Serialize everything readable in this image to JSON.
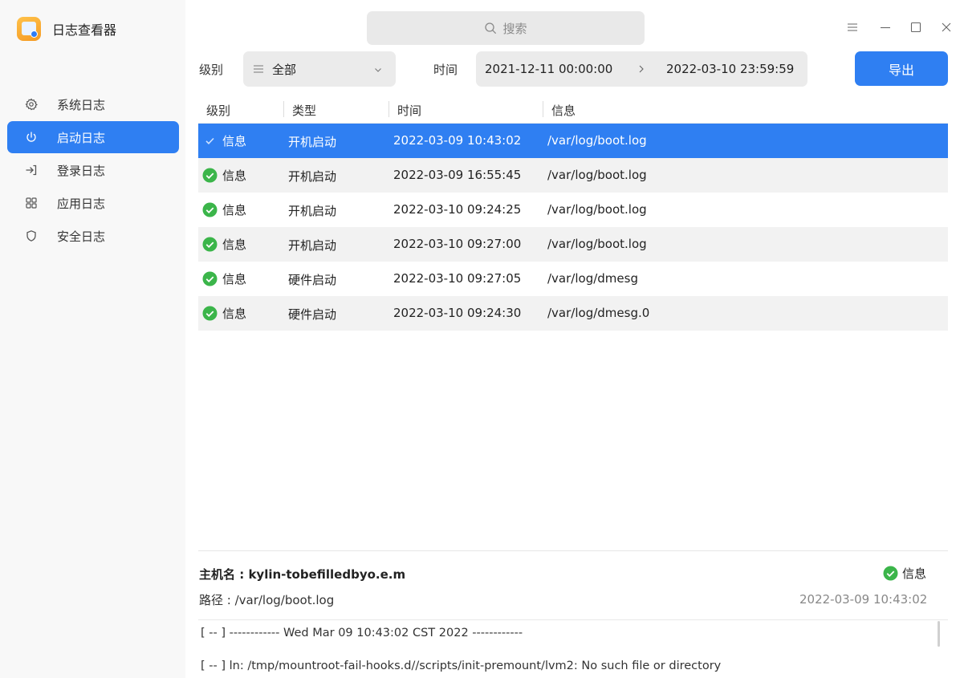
{
  "app": {
    "title": "日志查看器"
  },
  "search": {
    "placeholder": "搜索"
  },
  "sidebar": {
    "items": [
      {
        "label": "系统日志",
        "icon": "gear-icon",
        "active": false
      },
      {
        "label": "启动日志",
        "icon": "power-icon",
        "active": true
      },
      {
        "label": "登录日志",
        "icon": "login-icon",
        "active": false
      },
      {
        "label": "应用日志",
        "icon": "apps-grid-icon",
        "active": false
      },
      {
        "label": "安全日志",
        "icon": "shield-icon",
        "active": false
      }
    ]
  },
  "filters": {
    "level_label": "级别",
    "level_value": "全部",
    "time_label": "时间",
    "time_start": "2021-12-11 00:00:00",
    "time_end": "2022-03-10 23:59:59",
    "export_label": "导出"
  },
  "table": {
    "headers": [
      "级别",
      "类型",
      "时间",
      "信息"
    ],
    "rows": [
      {
        "level": "信息",
        "type": "开机启动",
        "time": "2022-03-09 10:43:02",
        "info": "/var/log/boot.log"
      },
      {
        "level": "信息",
        "type": "开机启动",
        "time": "2022-03-09 16:55:45",
        "info": "/var/log/boot.log"
      },
      {
        "level": "信息",
        "type": "开机启动",
        "time": "2022-03-10 09:24:25",
        "info": "/var/log/boot.log"
      },
      {
        "level": "信息",
        "type": "开机启动",
        "time": "2022-03-10 09:27:00",
        "info": "/var/log/boot.log"
      },
      {
        "level": "信息",
        "type": "硬件启动",
        "time": "2022-03-10 09:27:05",
        "info": "/var/log/dmesg"
      },
      {
        "level": "信息",
        "type": "硬件启动",
        "time": "2022-03-10 09:24:30",
        "info": "/var/log/dmesg.0"
      }
    ],
    "selected_index": 0
  },
  "detail": {
    "hostname": "主机名 : kylin-tobefilledbyo.e.m",
    "path": "路径 : /var/log/boot.log",
    "level": "信息",
    "time": "2022-03-09 10:43:02",
    "log_lines": [
      "[ -- ] ------------ Wed Mar 09 10:43:02 CST 2022 ------------",
      "[ -- ] ln: /tmp/mountroot-fail-hooks.d//scripts/init-premount/lvm2: No such file or directory"
    ]
  },
  "colors": {
    "accent": "#2f7ff2",
    "success": "#3bb54a",
    "sidebar_bg": "#f8f8f8",
    "stripe": "#f2f2f2"
  }
}
